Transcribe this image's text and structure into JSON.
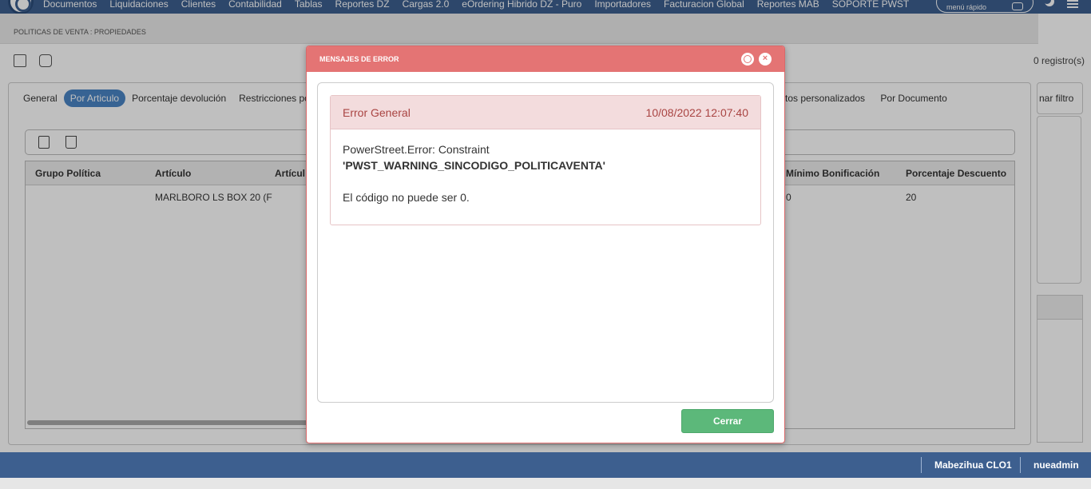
{
  "nav": {
    "items": [
      "Documentos",
      "Liquidaciones",
      "Clientes",
      "Contabilidad",
      "Tablas",
      "Reportes DZ",
      "Cargas 2.0",
      "eOrdering Hibrido DZ - Puro",
      "Importadores",
      "Facturacion Global",
      "Reportes MAB",
      "SOPORTE PWST"
    ],
    "quick_menu": "menú rápido"
  },
  "page": {
    "breadcrumb": "POLITICAS DE VENTA : PROPIEDADES",
    "records": "0 registro(s)",
    "filter_btn": "nar filtro",
    "tabs": [
      "General",
      "Por Articulo",
      "Porcentaje devolución",
      "Restricciones po"
    ],
    "tabs_right": [
      "tos personalizados",
      "Por Documento"
    ],
    "active_tab": "Por Articulo",
    "grid": {
      "columns": [
        "Grupo Política",
        "Artículo",
        "Artícul",
        "Mínimo Bonificación",
        "Porcentaje Descuento"
      ],
      "row": [
        "",
        "MARLBORO LS BOX 20 (F",
        "",
        "0",
        "20"
      ]
    }
  },
  "modal": {
    "title": "MENSAJES DE ERROR",
    "error_title": "Error General",
    "error_date": "10/08/2022 12:07:40",
    "line1": "PowerStreet.Error: Constraint",
    "line2": "'PWST_WARNING_SINCODIGO_POLITICAVENTA'",
    "line3": "El código no puede ser 0.",
    "close_btn": "Cerrar"
  },
  "footer": {
    "company": "Mabezihua CLO1",
    "user": "nueadmin"
  }
}
